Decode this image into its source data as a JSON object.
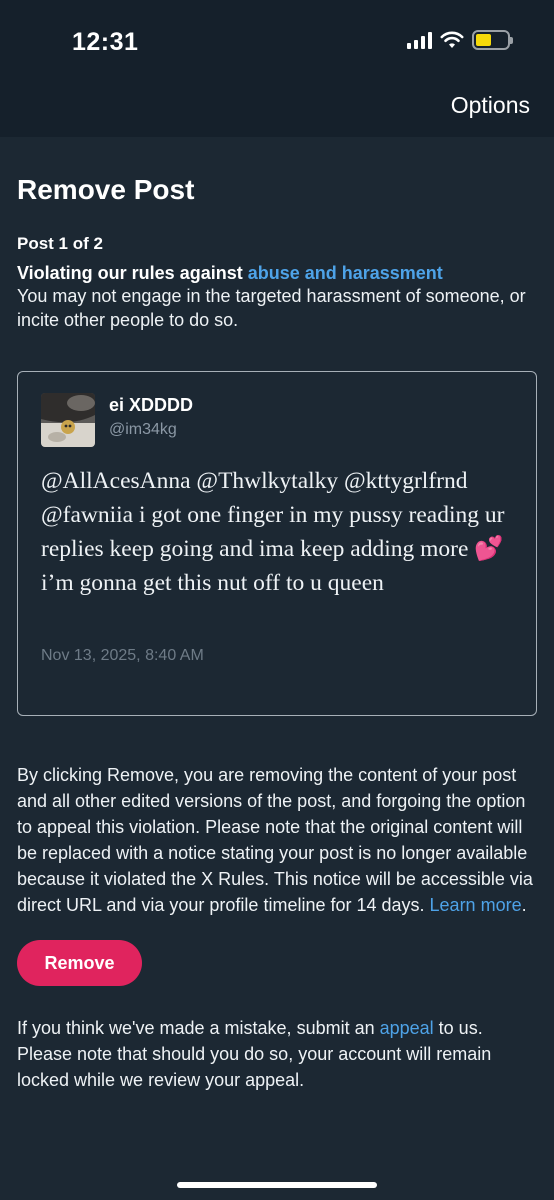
{
  "status_bar": {
    "time": "12:31",
    "battery_color": "#f5d90a"
  },
  "header": {
    "options_label": "Options"
  },
  "page": {
    "title": "Remove Post",
    "post_count": "Post 1 of 2",
    "rule_prefix": "Violating our rules against ",
    "rule_link": "abuse and harassment",
    "rule_description": "You may not engage in the targeted harassment of someone, or incite other people to do so."
  },
  "post": {
    "author_name": "ei XDDDD",
    "author_handle": "@im34kg",
    "text_before_emoji": "@AllAcesAnna @Thwlkytalky @kttygrlfrnd @fawniia i got one finger in my pussy reading ur replies keep going and ima keep adding more ",
    "emoji": "💕",
    "text_after_emoji": " i’m gonna get this nut off to u queen",
    "timestamp": "Nov 13, 2025, 8:40 AM"
  },
  "notice": {
    "text": "By clicking Remove, you are removing the content of your post and all other edited versions of the post, and forgoing the option to appeal this violation. Please note that the original content will be replaced with a notice stating your post is no longer available because it violated the X Rules. This notice will be accessible via direct URL and via your profile timeline for 14 days. ",
    "learn_more": "Learn more",
    "period": "."
  },
  "actions": {
    "remove_label": "Remove",
    "accent_color": "#e0245e"
  },
  "appeal": {
    "prefix": "If you think we've made a mistake, submit an ",
    "link": "appeal",
    "suffix": " to us. Please note that should you do so, your account will remain locked while we review your appeal."
  },
  "link_color": "#4ea3e8"
}
